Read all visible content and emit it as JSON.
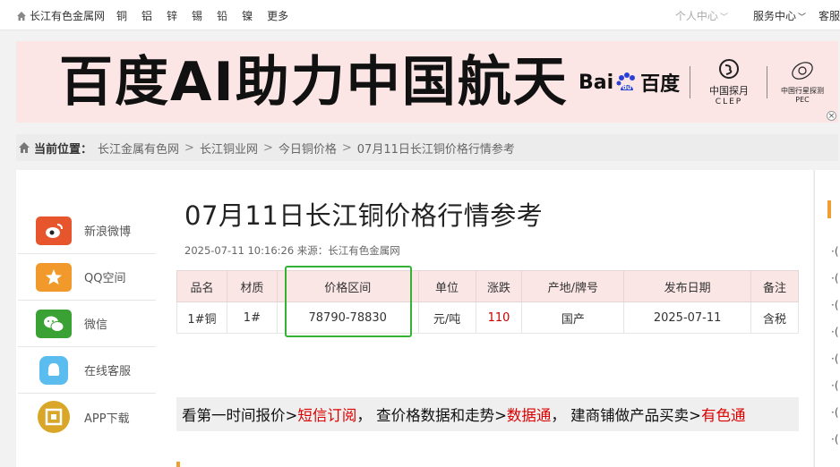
{
  "topnav": {
    "site_name": "长江有色金属网",
    "metals": [
      "铜",
      "铝",
      "锌",
      "锡",
      "铅",
      "镍",
      "更多"
    ],
    "user_center": "个人中心",
    "service_center": "服务中心",
    "service_cut": "客服"
  },
  "banner": {
    "headline": "百度AI助力中国航天",
    "baidu_left": "Bai",
    "baidu_mid": "du",
    "baidu_right": "百度",
    "clep_name": "中国探月",
    "clep_sub": "CLEP",
    "pec_name": "中国行星探测",
    "pec_sub": "PEC"
  },
  "breadcrumb": {
    "label": "当前位置：",
    "items": [
      "长江金属有色网",
      "长江铜业网",
      "今日铜价格",
      "07月11日长江铜价格行情参考"
    ],
    "separator": ">"
  },
  "share": [
    {
      "label": "新浪微博",
      "icon": "weibo-icon",
      "color": "#e6552b"
    },
    {
      "label": "QQ空间",
      "icon": "qzone-star-icon",
      "color": "#f19a2b"
    },
    {
      "label": "微信",
      "icon": "wechat-icon",
      "color": "#3aa135"
    },
    {
      "label": "在线客服",
      "icon": "chat-bubble-icon",
      "color": "#5bbcf0"
    },
    {
      "label": "APP下载",
      "icon": "app-logo-icon",
      "color": "#d9a628"
    }
  ],
  "article": {
    "title": "07月11日长江铜价格行情参考",
    "meta": "2025-07-11 10:16:26 来源：长江有色金属网"
  },
  "table": {
    "headers": [
      "品名",
      "材质",
      "价格区间",
      "单位",
      "涨跌",
      "产地/牌号",
      "发布日期",
      "备注"
    ],
    "row": [
      "1#铜",
      "1#",
      "78790-78830",
      "元/吨",
      "110",
      "国产",
      "2025-07-11",
      "含税"
    ]
  },
  "promo": {
    "p1": "看第一时间报价>",
    "l1": "短信订阅",
    "p2": "，  查价格数据和走势>",
    "l2": "数据通",
    "p3": "，  建商铺做产品买卖>",
    "l3": "有色通"
  },
  "colors": {
    "accent_orange": "#f0a030",
    "highlight_green": "#34b233",
    "rise_red": "#cc0000"
  }
}
